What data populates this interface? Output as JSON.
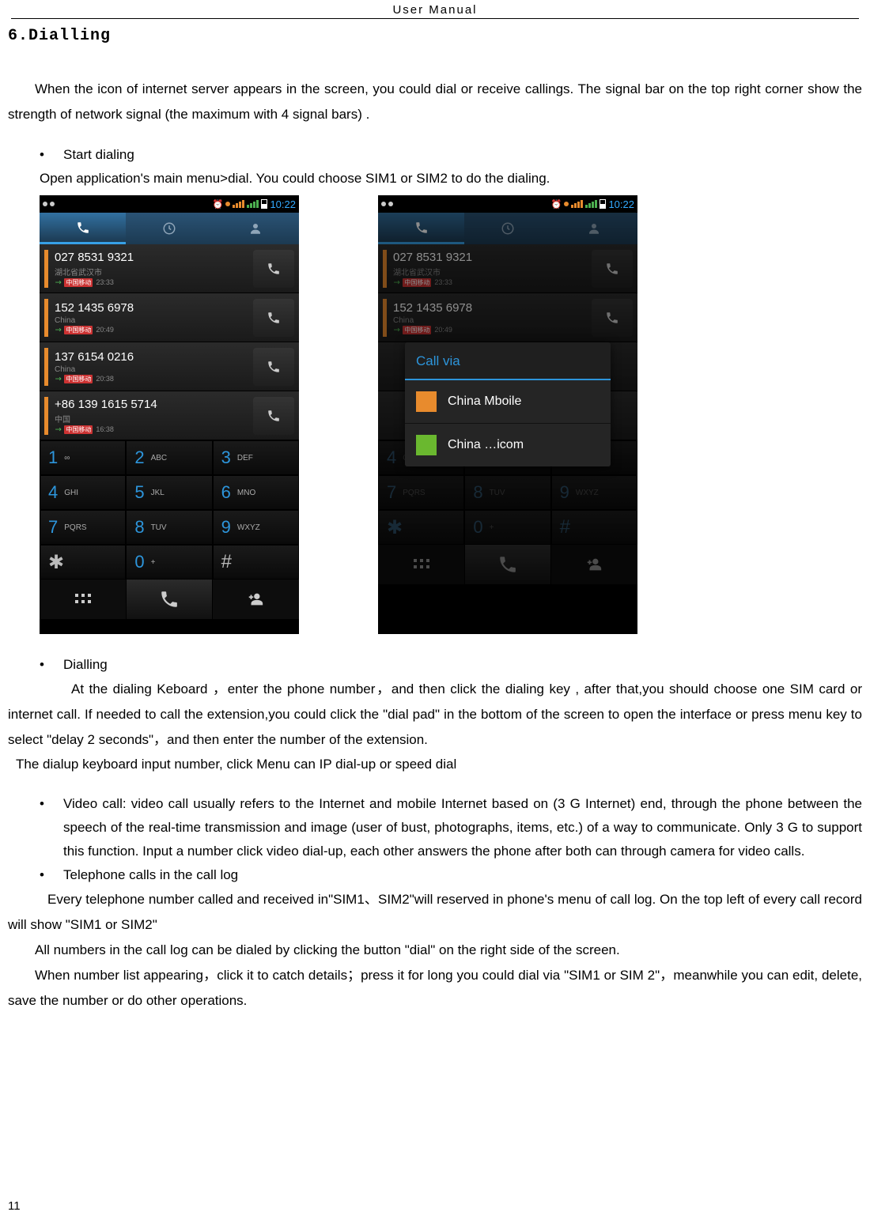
{
  "header": "User    Manual",
  "page_number": "11",
  "section_title": "6.Dialling",
  "intro": "When the icon of internet server appears in the screen, you could dial or receive callings. The signal bar on the top right corner show the strength of network signal (the maximum with 4 signal bars) .",
  "bullet_start_dialing": "Start dialing",
  "start_dialing_desc": "Open application's main menu>dial. You could choose SIM1 or SIM2 to do the dialing.",
  "bullet_dialling": "Dialling",
  "dialling_p1": "At the dialing Keboard  ，enter the phone number，and then click the dialing key , after that,you should choose one SIM card or internet call. If needed to call the extension,you could click the \"dial pad\" in the bottom of the screen to open the interface or press menu key to select \"delay 2 seconds\"，and then enter the number of the extension.",
  "dialling_p2": "The dialup keyboard input number, click Menu can IP dial-up or speed dial",
  "bullet_video": "Video call: video call usually refers to the Internet and mobile Internet based on (3 G Internet) end, through the phone between the speech of the real-time transmission and image (user of bust, photographs, items, etc.) of a way to communicate. Only 3 G to support this function. Input a number click video dial-up, each other answers the phone after both can through camera for video calls.",
  "bullet_tel_log": "Telephone calls in the call log",
  "tel_log_p1": "Every telephone number called and received in\"SIM1、SIM2\"will reserved in phone's menu of call log. On the top left of every call record will show \"SIM1 or SIM2\"",
  "tel_log_p2": "All numbers in the call log can be dialed by clicking the button \"dial\" on the right side of the screen.",
  "tel_log_p3": "When number list appearing，click it to catch details；press it for long you could dial via \"SIM1 or SIM 2\"，meanwhile you can edit, delete, save the number or do other operations.",
  "phone": {
    "time": "10:22",
    "calls": [
      {
        "number": "027 8531 9321",
        "loc": "湖北省武汉市",
        "carrier": "中国移动",
        "time": "23:33"
      },
      {
        "number": "152 1435 6978",
        "loc": "China",
        "carrier": "中国移动",
        "time": "20:49"
      },
      {
        "number": "137 6154 0216",
        "loc": "China",
        "carrier": "中国移动",
        "time": "20:38"
      },
      {
        "number": "+86 139 1615 5714",
        "loc": "中国",
        "carrier": "中国移动",
        "time": "16:38"
      }
    ],
    "keys": [
      {
        "d": "1",
        "l": "∞"
      },
      {
        "d": "2",
        "l": "ABC"
      },
      {
        "d": "3",
        "l": "DEF"
      },
      {
        "d": "4",
        "l": "GHI"
      },
      {
        "d": "5",
        "l": "JKL"
      },
      {
        "d": "6",
        "l": "MNO"
      },
      {
        "d": "7",
        "l": "PQRS"
      },
      {
        "d": "8",
        "l": "TUV"
      },
      {
        "d": "9",
        "l": "WXYZ"
      },
      {
        "d": "✱",
        "l": ""
      },
      {
        "d": "0",
        "l": "+"
      },
      {
        "d": "#",
        "l": ""
      }
    ],
    "dialog": {
      "title": "Call via",
      "opt1": "China Mboile",
      "opt2": "China …icom"
    }
  }
}
